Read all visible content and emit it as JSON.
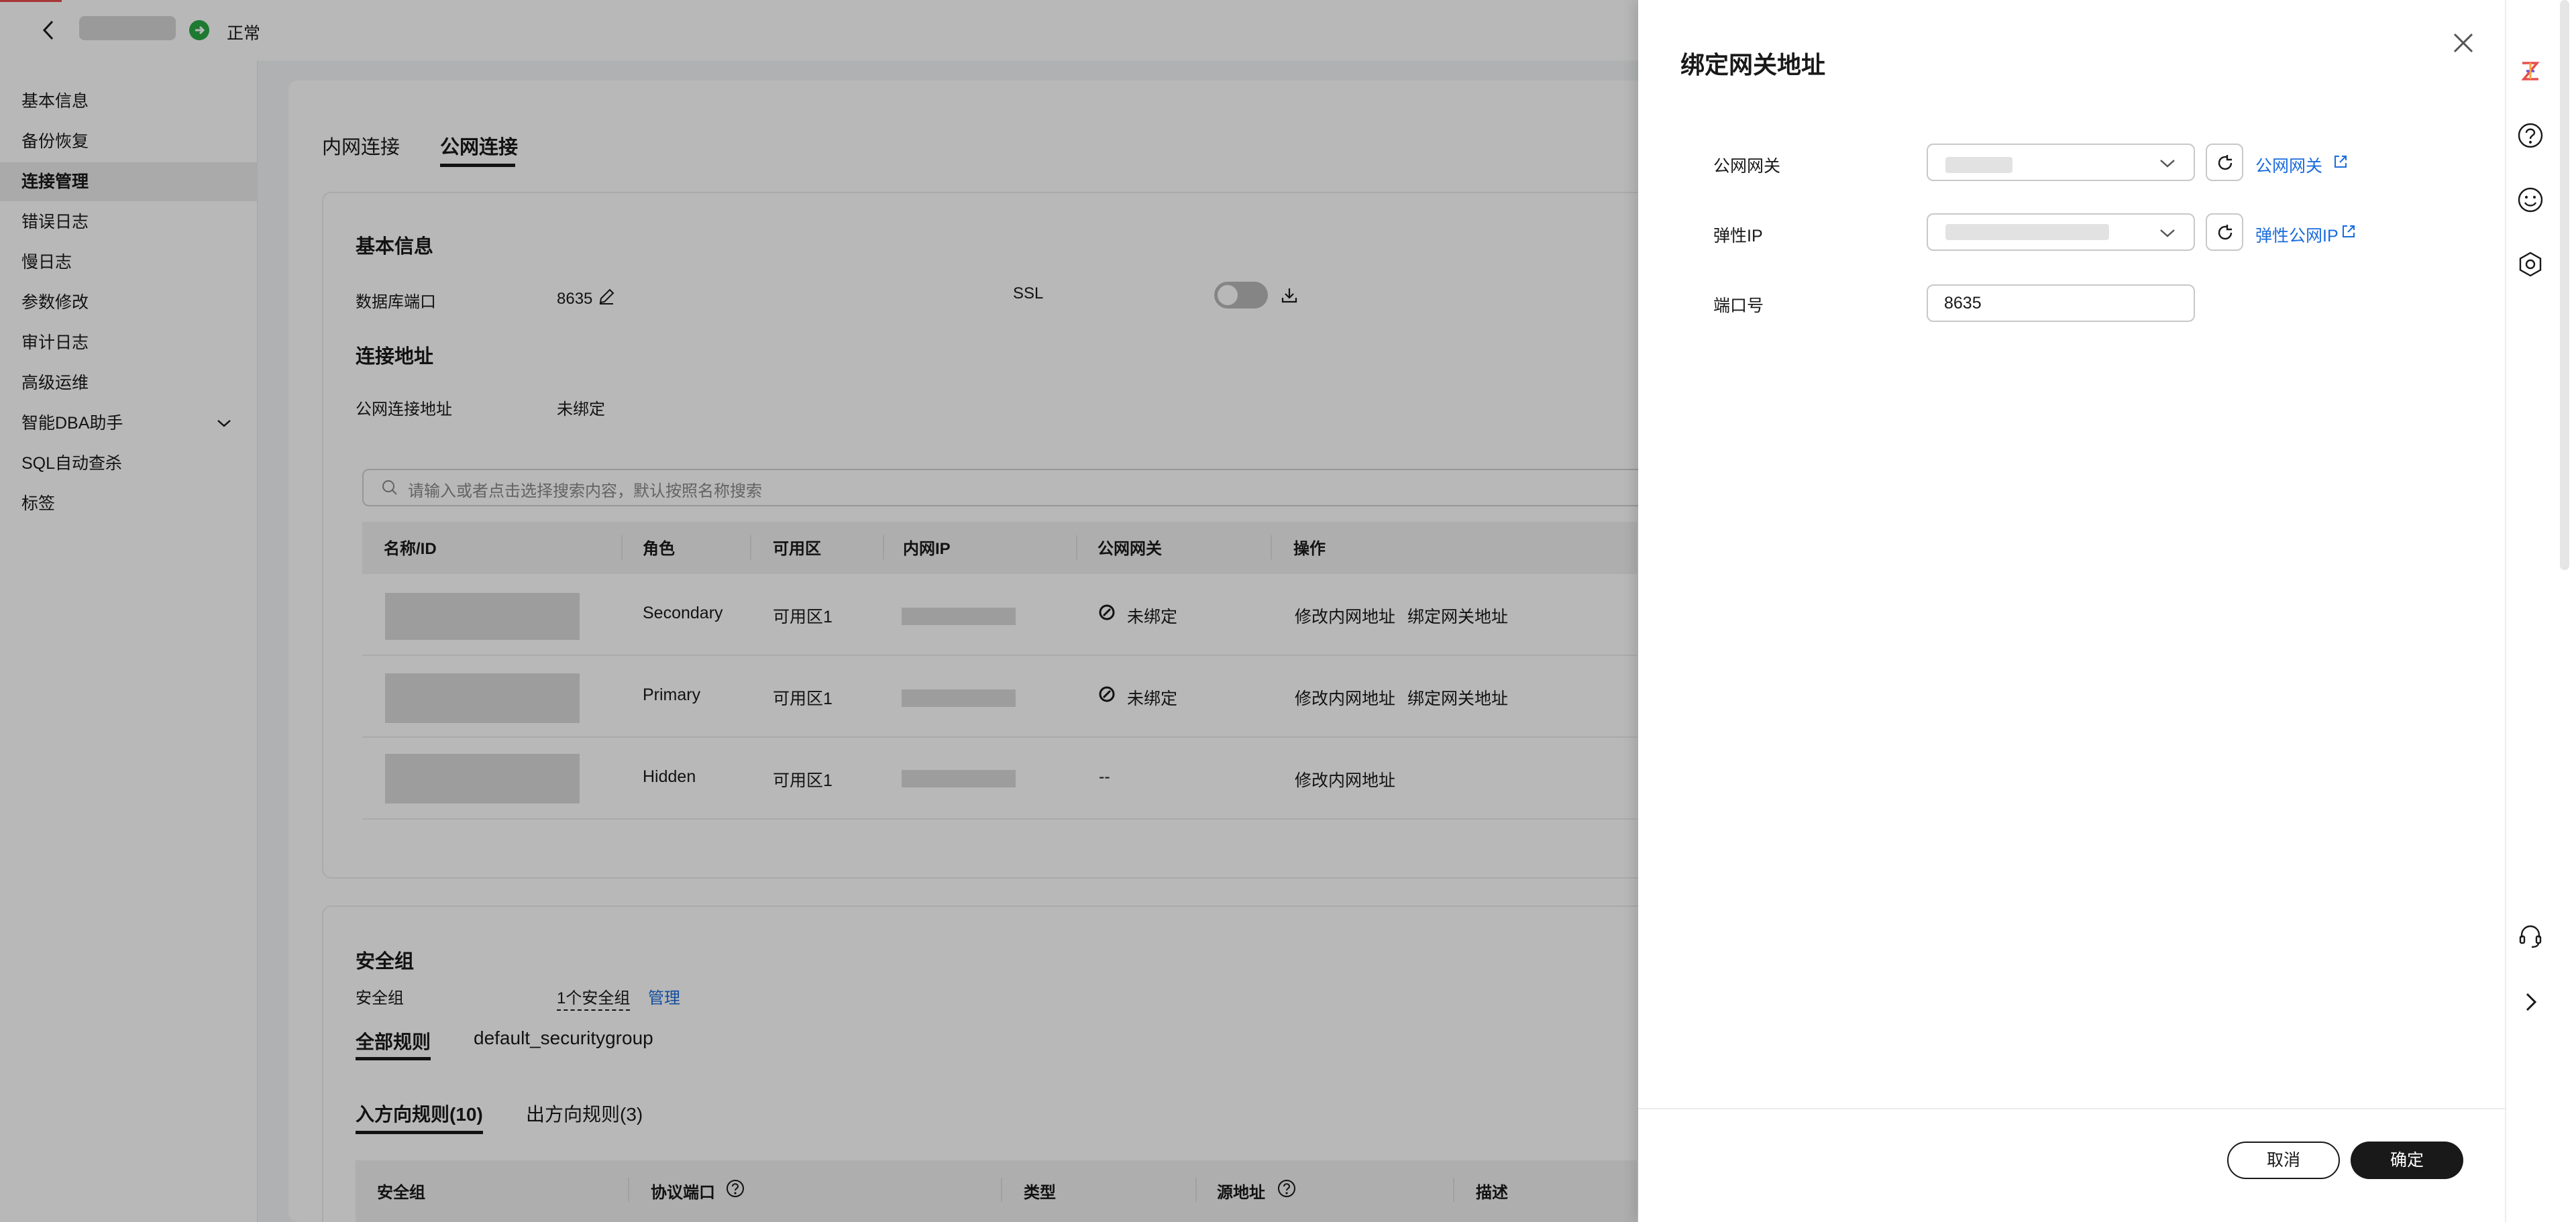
{
  "header": {
    "status": "正常"
  },
  "sidebar": {
    "items": [
      {
        "label": "基本信息"
      },
      {
        "label": "备份恢复"
      },
      {
        "label": "连接管理"
      },
      {
        "label": "错误日志"
      },
      {
        "label": "慢日志"
      },
      {
        "label": "参数修改"
      },
      {
        "label": "审计日志"
      },
      {
        "label": "高级运维"
      },
      {
        "label": "智能DBA助手"
      },
      {
        "label": "SQL自动查杀"
      },
      {
        "label": "标签"
      }
    ],
    "active_item": "连接管理"
  },
  "main": {
    "tabs": [
      {
        "label": "内网连接"
      },
      {
        "label": "公网连接"
      }
    ],
    "active_tab": "公网连接",
    "basic_info": {
      "title": "基本信息",
      "db_port_label": "数据库端口",
      "db_port_value": "8635",
      "ssl_label": "SSL",
      "ssl_enabled": false
    },
    "address": {
      "title": "连接地址",
      "public_address_label": "公网连接地址",
      "public_address_value": "未绑定"
    },
    "search": {
      "placeholder": "请输入或者点击选择搜索内容，默认按照名称搜索"
    },
    "table": {
      "columns": [
        "名称/ID",
        "角色",
        "可用区",
        "内网IP",
        "公网网关",
        "操作"
      ],
      "rows": [
        {
          "role": "Secondary",
          "az": "可用区1",
          "gateway": "未绑定",
          "actions": [
            "修改内网地址",
            "绑定网关地址"
          ]
        },
        {
          "role": "Primary",
          "az": "可用区1",
          "gateway": "未绑定",
          "actions": [
            "修改内网地址",
            "绑定网关地址"
          ]
        },
        {
          "role": "Hidden",
          "az": "可用区1",
          "gateway": "--",
          "actions": [
            "修改内网地址"
          ]
        }
      ]
    },
    "security": {
      "title": "安全组",
      "label": "安全组",
      "count_link": "1个安全组",
      "manage_link": "管理",
      "group_tabs": [
        "全部规则",
        "default_securitygroup"
      ],
      "direction_tabs": [
        "入方向规则(10)",
        "出方向规则(3)"
      ],
      "columns": [
        "安全组",
        "协议端口",
        "类型",
        "源地址",
        "描述"
      ]
    }
  },
  "drawer": {
    "title": "绑定网关地址",
    "fields": {
      "gateway_label": "公网网关",
      "gateway_link": "公网网关",
      "eip_label": "弹性IP",
      "eip_link": "弹性公网IP",
      "port_label": "端口号",
      "port_value": "8635"
    },
    "cancel_label": "取消",
    "confirm_label": "确定"
  },
  "colors": {
    "accent": "#1a6cdc",
    "status_green": "#2aa845",
    "primary_button": "#191919"
  }
}
